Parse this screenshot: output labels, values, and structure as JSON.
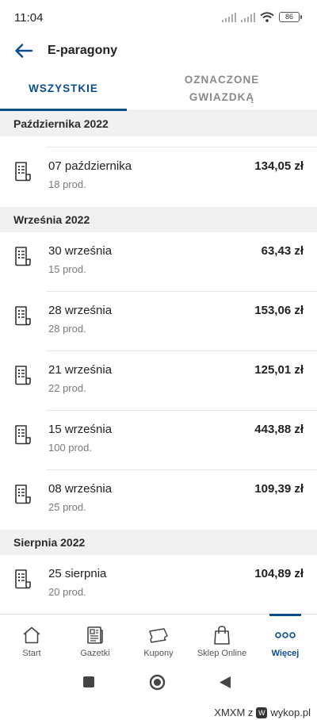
{
  "status_bar": {
    "time": "11:04",
    "battery": "86"
  },
  "app_bar": {
    "title": "E-paragony"
  },
  "tabs": [
    {
      "label": "WSZYSTKIE",
      "active": true
    },
    {
      "label": "OZNACZONE GWIAZDKĄ",
      "active": false
    }
  ],
  "sections": [
    {
      "header": "Października 2022",
      "rows": [
        {
          "date": "07 października",
          "count": "18 prod.",
          "amount": "134,05 zł"
        }
      ]
    },
    {
      "header": "Września 2022",
      "rows": [
        {
          "date": "30 września",
          "count": "15 prod.",
          "amount": "63,43 zł"
        },
        {
          "date": "28 września",
          "count": "28 prod.",
          "amount": "153,06 zł"
        },
        {
          "date": "21 września",
          "count": "22 prod.",
          "amount": "125,01 zł"
        },
        {
          "date": "15 września",
          "count": "100 prod.",
          "amount": "443,88 zł"
        },
        {
          "date": "08 września",
          "count": "25 prod.",
          "amount": "109,39 zł"
        }
      ]
    },
    {
      "header": "Sierpnia 2022",
      "rows": [
        {
          "date": "25 sierpnia",
          "count": "20 prod.",
          "amount": "104,89 zł"
        }
      ]
    }
  ],
  "bottom_nav": [
    {
      "label": "Start",
      "icon": "home-icon",
      "active": false
    },
    {
      "label": "Gazetki",
      "icon": "newspaper-icon",
      "active": false
    },
    {
      "label": "Kupony",
      "icon": "coupon-icon",
      "active": false
    },
    {
      "label": "Sklep Online",
      "icon": "shopping-bag-icon",
      "active": false
    },
    {
      "label": "Więcej",
      "icon": "more-dots-icon",
      "active": true
    }
  ],
  "watermark": {
    "text": "XMXM z",
    "site": "wykop.pl"
  },
  "colors": {
    "accent": "#0a4d8c",
    "section_bg": "#f1f1f1"
  }
}
